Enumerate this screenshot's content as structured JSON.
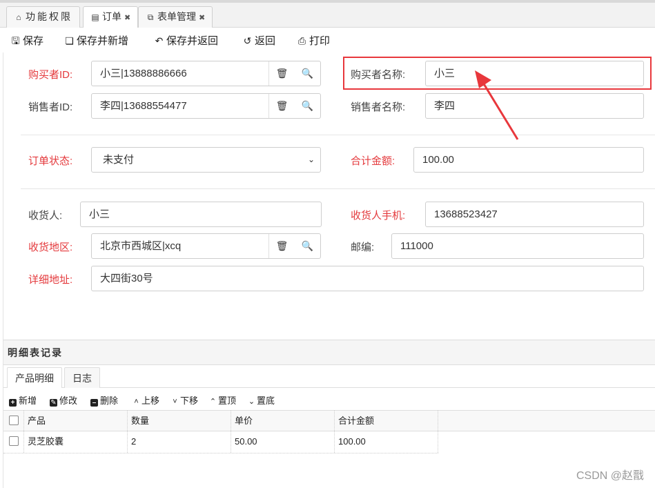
{
  "tabs": [
    {
      "label": "功能权限",
      "icon": "home-icon",
      "closable": false,
      "active": false
    },
    {
      "label": "订单",
      "icon": "document-icon",
      "closable": true,
      "active": true
    },
    {
      "label": "表单管理",
      "icon": "window-icon",
      "closable": true,
      "active": false
    }
  ],
  "toolbar": {
    "save": "保存",
    "save_new": "保存并新增",
    "save_return": "保存并返回",
    "back": "返回",
    "print": "打印"
  },
  "form": {
    "buyer_id_label": "购买者ID:",
    "buyer_id_value": "小三|13888886666",
    "buyer_name_label": "购买者名称:",
    "buyer_name_value": "小三",
    "seller_id_label": "销售者ID:",
    "seller_id_value": "李四|13688554477",
    "seller_name_label": "销售者名称:",
    "seller_name_value": "李四",
    "order_status_label": "订单状态:",
    "order_status_value": "未支付",
    "total_label": "合计金额:",
    "total_value": "100.00",
    "receiver_label": "收货人:",
    "receiver_value": "小三",
    "receiver_phone_label": "收货人手机:",
    "receiver_phone_value": "13688523427",
    "region_label": "收货地区:",
    "region_value": "北京市西城区|xcq",
    "postcode_label": "邮编:",
    "postcode_value": "111000",
    "address_label": "详细地址:",
    "address_value": "大四街30号"
  },
  "detail": {
    "title": "明细表记录",
    "subtabs": [
      "产品明细",
      "日志"
    ],
    "actions": {
      "add": "新增",
      "edit": "修改",
      "delete": "删除",
      "up": "上移",
      "down": "下移",
      "top": "置顶",
      "bottom": "置底"
    },
    "columns": [
      "产品",
      "数量",
      "单价",
      "合计金额"
    ],
    "rows": [
      [
        "灵芝胶囊",
        "2",
        "50.00",
        "100.00"
      ]
    ]
  },
  "watermark": "CSDN @赵戬",
  "colors": {
    "required_label": "#e4393c",
    "highlight_box": "#e8373c",
    "arrow": "#e8373c"
  }
}
